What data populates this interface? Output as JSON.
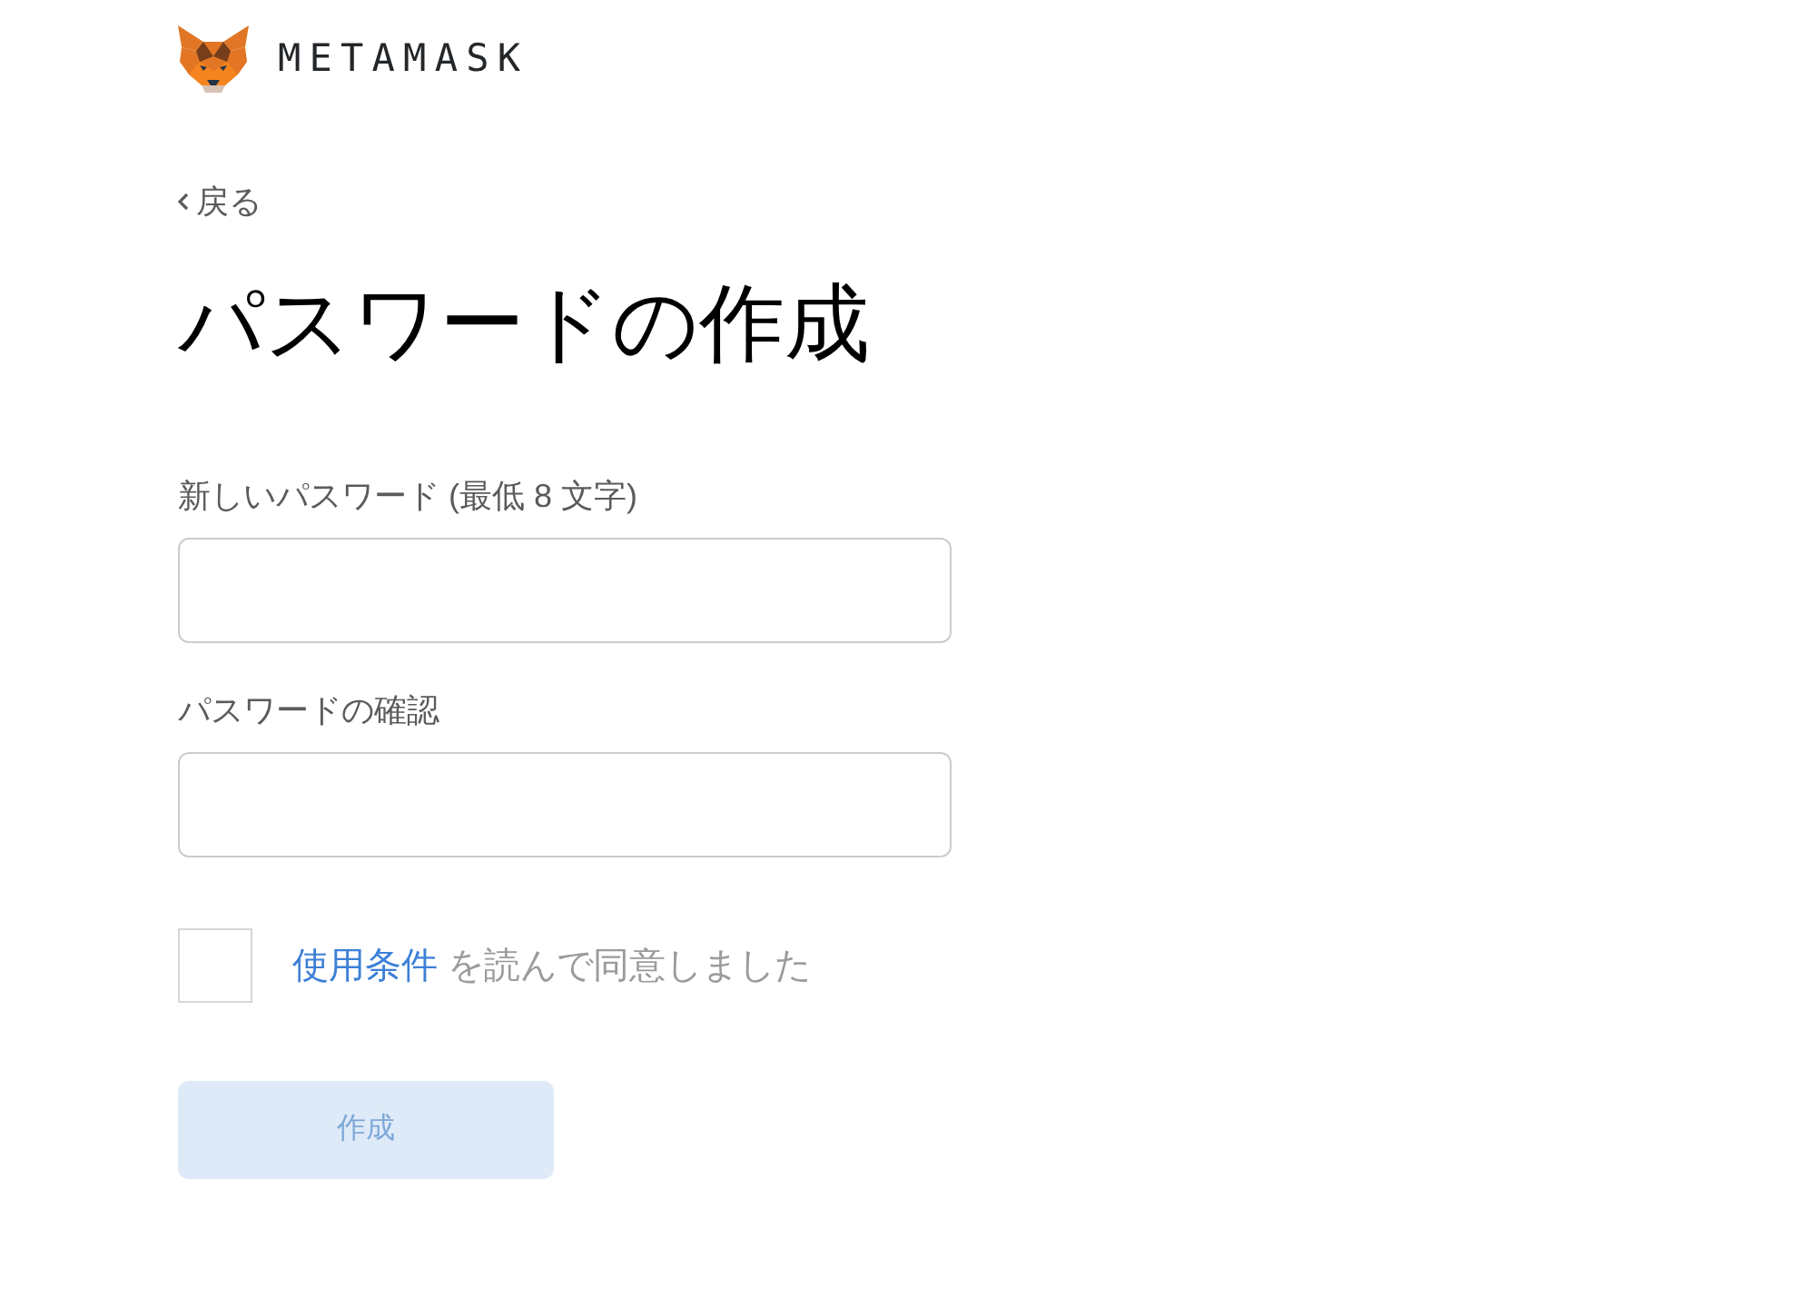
{
  "header": {
    "logo_text": "METAMASK"
  },
  "back_link": {
    "label": "戻る"
  },
  "title": "パスワードの作成",
  "fields": [
    {
      "label": "新しいパスワード (最低 8 文字)"
    },
    {
      "label": "パスワードの確認"
    }
  ],
  "terms": {
    "checked": false,
    "link": "使用条件",
    "text": "を読んで同意しました"
  },
  "create_button": {
    "label": "作成",
    "disabled": true
  }
}
